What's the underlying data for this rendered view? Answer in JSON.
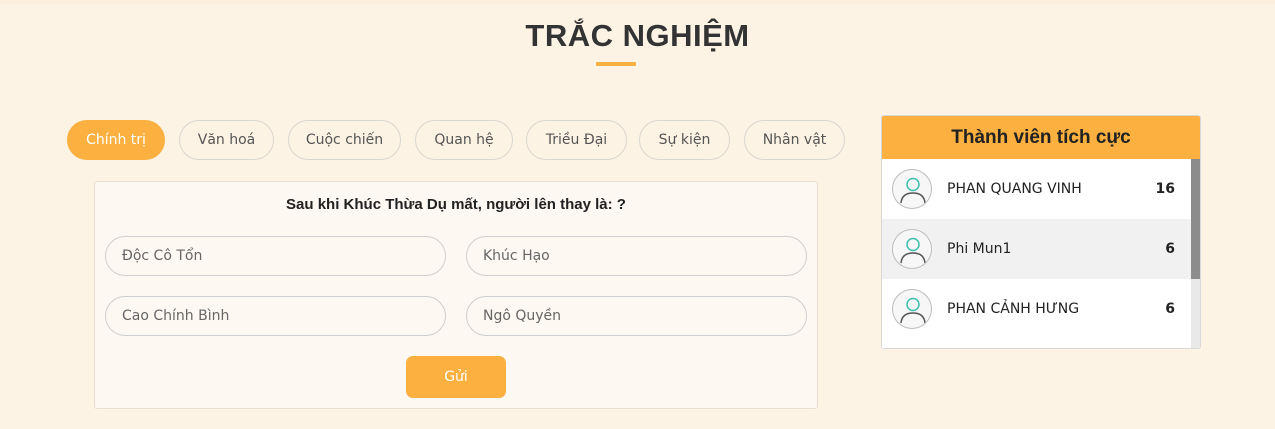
{
  "page": {
    "title": "TRẮC NGHIỆM"
  },
  "categories": [
    {
      "label": "Chính trị",
      "active": true
    },
    {
      "label": "Văn hoá",
      "active": false
    },
    {
      "label": "Cuộc chiến",
      "active": false
    },
    {
      "label": "Quan hệ",
      "active": false
    },
    {
      "label": "Triều Đại",
      "active": false
    },
    {
      "label": "Sự kiện",
      "active": false
    },
    {
      "label": "Nhân vật",
      "active": false
    }
  ],
  "quiz": {
    "question": "Sau khi Khúc Thừa Dụ mất, người lên thay là: ?",
    "answers": [
      "Độc Cô Tổn",
      "Khúc Hạo",
      "Cao Chính Bình",
      "Ngô Quyền"
    ],
    "submit_label": "Gửi"
  },
  "leaderboard": {
    "title": "Thành viên tích cực",
    "members": [
      {
        "name": "PHAN QUANG VINH",
        "score": "16"
      },
      {
        "name": "Phi Mun1",
        "score": "6"
      },
      {
        "name": "PHAN CẢNH HƯNG",
        "score": "6"
      }
    ]
  },
  "colors": {
    "accent": "#fbb040",
    "background": "#fdf3e4",
    "avatar_icon": "#3cbfae"
  },
  "icons": {
    "avatar": "user-avatar-icon"
  }
}
